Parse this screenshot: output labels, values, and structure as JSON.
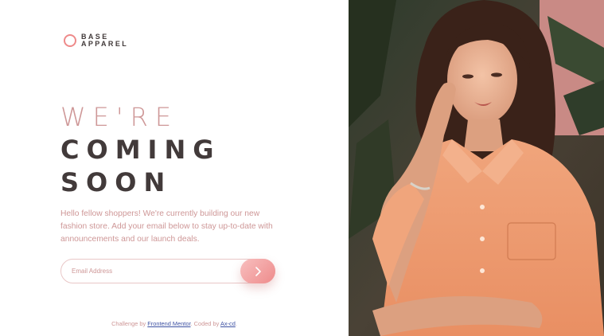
{
  "logo": {
    "line1": "BASE",
    "line2": "APPAREL"
  },
  "headline": {
    "light": "WE'RE",
    "dark1": "COMING",
    "dark2": "SOON"
  },
  "description": "Hello fellow shoppers! We're currently building our new fashion store. Add your email below to stay up-to-date with announcements and our launch deals.",
  "form": {
    "placeholder": "Email Address",
    "submit_icon": "chevron-right-icon"
  },
  "attribution": {
    "prefix": "Challenge by",
    "link1": "Frontend Mentor",
    "middle": ". Coded by",
    "link2": "Ax-cd",
    "suffix": "."
  },
  "hero": {
    "image_icon": "woman-portrait-photo"
  },
  "colors": {
    "accent": "#ee8a8a",
    "text_dark": "#423a3a",
    "text_pink": "#ce9797",
    "link": "#3e52a3"
  }
}
